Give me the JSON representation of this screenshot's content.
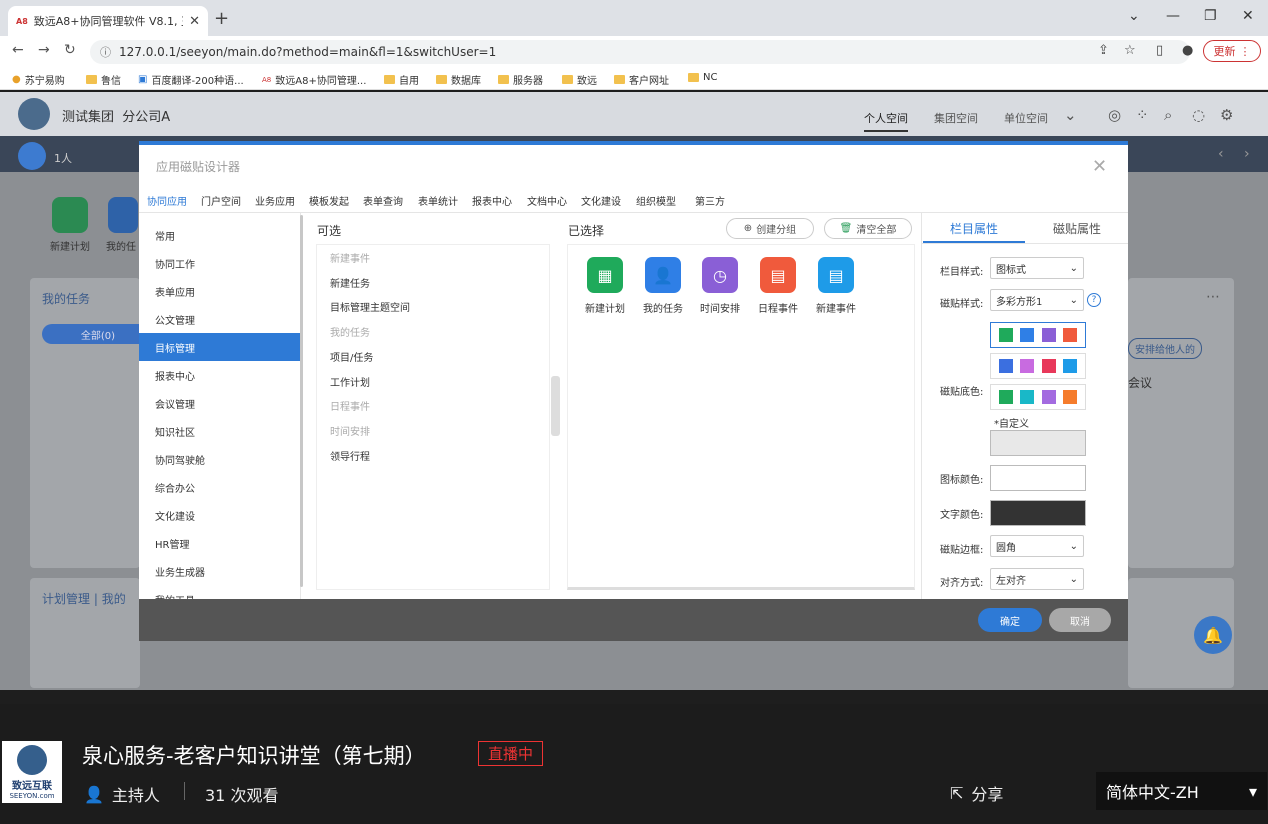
{
  "browser": {
    "tab_title": "致远A8+协同管理软件 V8.1, 王…",
    "tab_favicon": "A8",
    "url": "127.0.0.1/seeyon/main.do?method=main&fl=1&switchUser=1",
    "update_label": "更新",
    "bookmarks": [
      "苏宁易购",
      "鲁信",
      "百度翻译-200种语...",
      "致远A8+协同管理...",
      "自用",
      "数据库",
      "服务器",
      "致远",
      "客户网址",
      "NC"
    ]
  },
  "app": {
    "org": "测试集团",
    "unit": "分公司A",
    "nav": [
      "个人空间",
      "集团空间",
      "单位空间"
    ],
    "people_count": "1人",
    "workspace": {
      "tiles": [
        "新建计划",
        "我的任"
      ],
      "my_tasks": "我的任务",
      "all_pill": "全部(0)",
      "plan_mgmt": "计划管理",
      "plan_mgmt_sub": "我的",
      "assign_pill": "安排给他人的",
      "meeting": "会议"
    }
  },
  "modal": {
    "title": "应用磁贴设计器",
    "tabs": [
      "协同应用",
      "门户空间",
      "业务应用",
      "模板发起",
      "表单查询",
      "表单统计",
      "报表中心",
      "文档中心",
      "文化建设",
      "组织模型",
      "第三方"
    ],
    "left_nav": [
      "常用",
      "协同工作",
      "表单应用",
      "公文管理",
      "目标管理",
      "报表中心",
      "会议管理",
      "知识社区",
      "协同驾驶舱",
      "综合办公",
      "文化建设",
      "HR管理",
      "业务生成器",
      "我的工具"
    ],
    "optional_head": "可选",
    "optional_items": [
      {
        "label": "新建事件",
        "group": true
      },
      {
        "label": "新建任务",
        "group": false
      },
      {
        "label": "目标管理主题空间",
        "group": false
      },
      {
        "label": "我的任务",
        "group": true
      },
      {
        "label": "项目/任务",
        "group": false
      },
      {
        "label": "工作计划",
        "group": false
      },
      {
        "label": "日程事件",
        "group": true
      },
      {
        "label": "时间安排",
        "group": true
      },
      {
        "label": "领导行程",
        "group": false
      }
    ],
    "selected_head": "已选择",
    "create_group": "创建分组",
    "clear_all": "清空全部",
    "selected_tiles": [
      {
        "label": "新建计划",
        "color": "#1faa5b",
        "icon": "calendar-grid-icon"
      },
      {
        "label": "我的任务",
        "color": "#2f7fe6",
        "icon": "user-check-icon"
      },
      {
        "label": "时间安排",
        "color": "#8a5fd6",
        "icon": "calendar-clock-icon"
      },
      {
        "label": "日程事件",
        "color": "#f05a3c",
        "icon": "calendar-icon"
      },
      {
        "label": "新建事件",
        "color": "#1e9be8",
        "icon": "calendar-icon"
      }
    ],
    "right_tabs": [
      "栏目属性",
      "磁贴属性"
    ],
    "props": {
      "column_style_label": "栏目样式:",
      "column_style_value": "图标式",
      "tile_style_label": "磁贴样式:",
      "tile_style_value": "多彩方形1",
      "tile_bg_label": "磁贴底色:",
      "swatches": [
        [
          "#1faa5b",
          "#2f7fe6",
          "#8a5fd6",
          "#f05a3c"
        ],
        [
          "#3b6fe0",
          "#c86be0",
          "#e8385a",
          "#1e9be8"
        ],
        [
          "#1faa5b",
          "#19b8c8",
          "#a36be0",
          "#f57c2c"
        ]
      ],
      "custom_label": "*自定义",
      "custom_color": "#e8e8e8",
      "icon_color_label": "图标颜色:",
      "icon_color": "#ffffff",
      "text_color_label": "文字颜色:",
      "text_color": "#333333",
      "border_label": "磁贴边框:",
      "border_value": "圆角",
      "align_label": "对齐方式:",
      "align_value": "左对齐"
    },
    "ok": "确定",
    "cancel": "取消"
  },
  "stream": {
    "logo_cn": "致远互联",
    "logo_en": "SEEYON.com",
    "title": "泉心服务-老客户知识讲堂（第七期）",
    "live_badge": "直播中",
    "host": "主持人",
    "views": "31 次观看",
    "share": "分享",
    "language": "简体中文-ZH"
  }
}
